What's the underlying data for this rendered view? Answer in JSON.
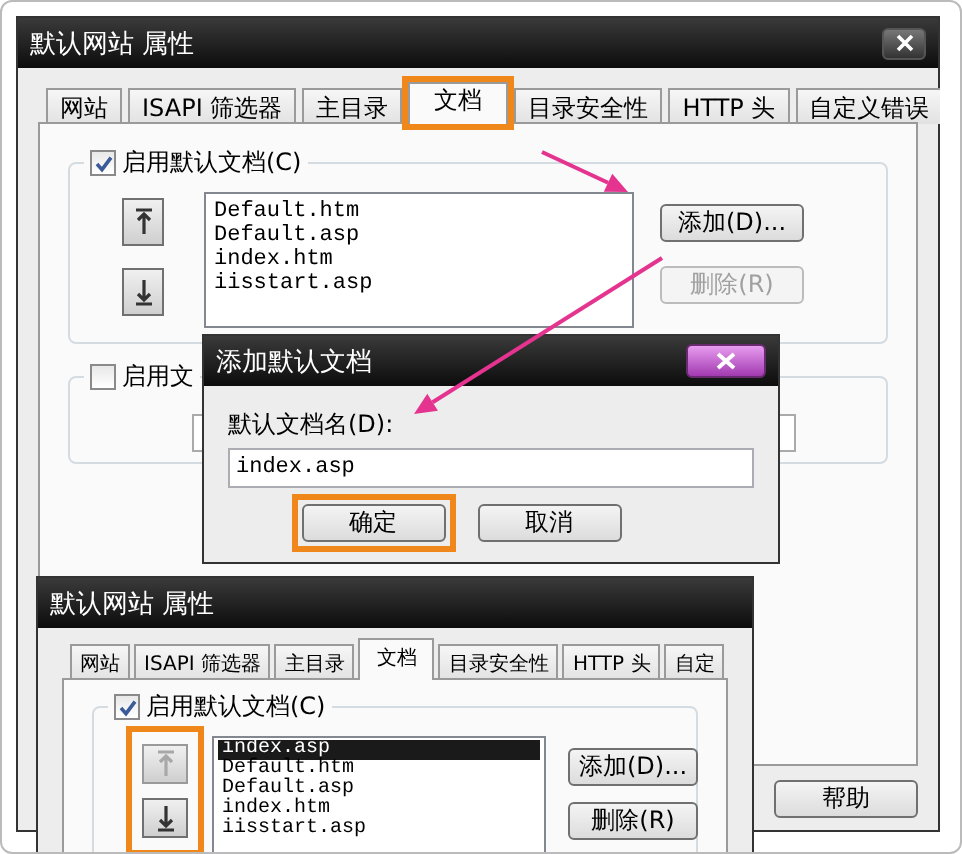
{
  "main_window": {
    "title": "默认网站 属性",
    "tabs": [
      {
        "label": "网站",
        "selected": false,
        "highlighted": false
      },
      {
        "label": "ISAPI 筛选器",
        "selected": false,
        "highlighted": false
      },
      {
        "label": "主目录",
        "selected": false,
        "highlighted": false
      },
      {
        "label": "文档",
        "selected": true,
        "highlighted": true
      },
      {
        "label": "目录安全性",
        "selected": false,
        "highlighted": false
      },
      {
        "label": "HTTP 头",
        "selected": false,
        "highlighted": false
      },
      {
        "label": "自定义错误",
        "selected": false,
        "highlighted": false
      }
    ],
    "default_document": {
      "label": "启用默认文档(C)",
      "checked": true
    },
    "move_buttons": [
      {
        "kind": "up",
        "disabled": false
      },
      {
        "kind": "down",
        "disabled": false
      }
    ],
    "documents": [
      {
        "name": "Default.htm",
        "selected": false
      },
      {
        "name": "Default.asp",
        "selected": false
      },
      {
        "name": "index.htm",
        "selected": false
      },
      {
        "name": "iisstart.asp",
        "selected": false
      }
    ],
    "add_button": {
      "label": "添加(D)...",
      "disabled": false
    },
    "remove_button": {
      "label": "删除(R)",
      "disabled": true
    },
    "footer": {
      "label": "启用文",
      "checked": false
    },
    "help_button": {
      "label": "帮助"
    }
  },
  "add_dialog": {
    "title": "添加默认文档",
    "field_label": "默认文档名(D):",
    "value": "index.asp",
    "buttons": [
      {
        "label": "确定",
        "highlighted": true
      },
      {
        "label": "取消",
        "highlighted": false
      }
    ]
  },
  "preview_window": {
    "title": "默认网站 属性",
    "tabs": [
      {
        "label": "网站",
        "selected": false,
        "highlighted": false
      },
      {
        "label": "ISAPI 筛选器",
        "selected": false,
        "highlighted": false
      },
      {
        "label": "主目录",
        "selected": false,
        "highlighted": false
      },
      {
        "label": "文档",
        "selected": true,
        "highlighted": false
      },
      {
        "label": "目录安全性",
        "selected": false,
        "highlighted": false
      },
      {
        "label": "HTTP 头",
        "selected": false,
        "highlighted": false
      },
      {
        "label": "自定",
        "selected": false,
        "highlighted": false
      }
    ],
    "default_document": {
      "label": "启用默认文档(C)",
      "checked": true
    },
    "move_buttons": [
      {
        "kind": "up",
        "disabled": true
      },
      {
        "kind": "down",
        "disabled": false
      }
    ],
    "move_buttons_highlighted": true,
    "documents": [
      {
        "name": "index.asp",
        "selected": true
      },
      {
        "name": "Default.htm",
        "selected": false
      },
      {
        "name": "Default.asp",
        "selected": false
      },
      {
        "name": "index.htm",
        "selected": false
      },
      {
        "name": "iisstart.asp",
        "selected": false
      }
    ],
    "add_button": {
      "label": "添加(D)...",
      "disabled": false
    },
    "remove_button": {
      "label": "删除(R)",
      "disabled": false
    }
  }
}
